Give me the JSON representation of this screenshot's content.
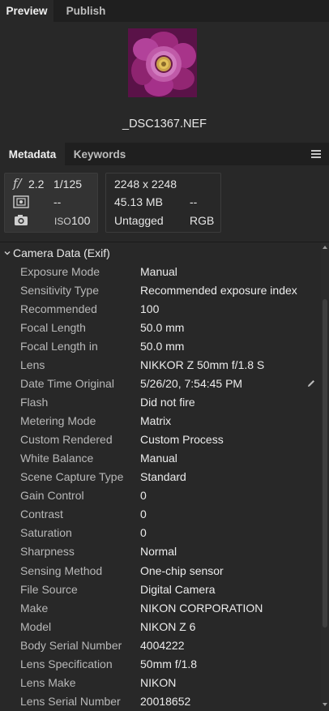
{
  "top_tabs": [
    {
      "label": "Preview",
      "active": true
    },
    {
      "label": "Publish",
      "active": false
    }
  ],
  "preview": {
    "filename": "_DSC1367.NEF"
  },
  "panel_tabs": [
    {
      "label": "Metadata",
      "active": true
    },
    {
      "label": "Keywords",
      "active": false
    }
  ],
  "summary": {
    "aperture": "2.2",
    "shutter": "1/125",
    "metering": "--",
    "iso_label": "ISO",
    "iso": "100",
    "dimensions": "2248 x 2248",
    "size": "45.13 MB",
    "size_extra": "--",
    "label": "Untagged",
    "color_mode": "RGB"
  },
  "section": {
    "title": "Camera Data (Exif)",
    "rows": [
      {
        "key": "Exposure Mode",
        "value": "Manual"
      },
      {
        "key": "Sensitivity Type",
        "value": "Recommended exposure index"
      },
      {
        "key": "Recommended",
        "value": "100"
      },
      {
        "key": "Focal Length",
        "value": "50.0 mm"
      },
      {
        "key": "Focal Length in",
        "value": "50.0 mm"
      },
      {
        "key": "Lens",
        "value": "NIKKOR Z 50mm f/1.8 S"
      },
      {
        "key": "Date Time Original",
        "value": "5/26/20, 7:54:45 PM"
      },
      {
        "key": "Flash",
        "value": "Did not fire"
      },
      {
        "key": "Metering Mode",
        "value": "Matrix"
      },
      {
        "key": "Custom Rendered",
        "value": "Custom Process"
      },
      {
        "key": "White Balance",
        "value": "Manual"
      },
      {
        "key": "Scene Capture Type",
        "value": "Standard"
      },
      {
        "key": "Gain Control",
        "value": "0"
      },
      {
        "key": "Contrast",
        "value": "0"
      },
      {
        "key": "Saturation",
        "value": "0"
      },
      {
        "key": "Sharpness",
        "value": "Normal"
      },
      {
        "key": "Sensing Method",
        "value": "One-chip sensor"
      },
      {
        "key": "File Source",
        "value": "Digital Camera"
      },
      {
        "key": "Make",
        "value": "NIKON CORPORATION"
      },
      {
        "key": "Model",
        "value": "NIKON Z 6"
      },
      {
        "key": "Body Serial Number",
        "value": "4004222"
      },
      {
        "key": "Lens Specification",
        "value": "50mm f/1.8"
      },
      {
        "key": "Lens Make",
        "value": "NIKON"
      },
      {
        "key": "Lens Serial Number",
        "value": "20018652"
      }
    ]
  },
  "icons": {
    "aperture": "f-stop-icon",
    "metering": "metering-icon",
    "camera": "camera-icon",
    "edit": "pencil-icon",
    "menu": "panel-menu-icon",
    "chevron": "chevron-down-icon"
  },
  "colors": {
    "panel_bg": "#282828",
    "tabbar_bg": "#1f1f1f",
    "flower": "#b03a8a"
  }
}
